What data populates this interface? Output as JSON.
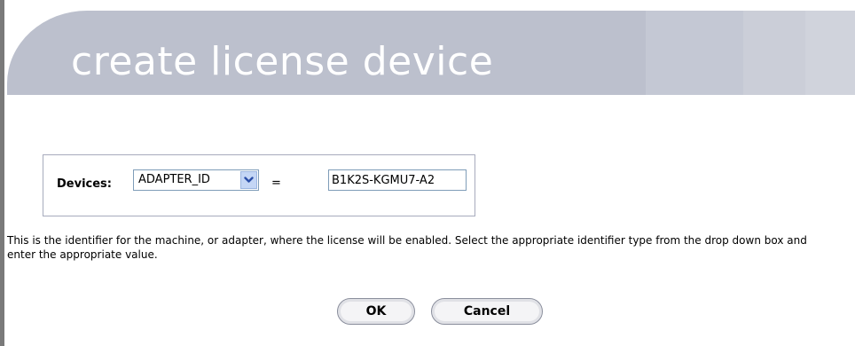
{
  "header": {
    "title": "create license device"
  },
  "device_form": {
    "label": "Devices:",
    "select": {
      "selected": "ADAPTER_ID",
      "arrow_icon": "chevron-down-icon"
    },
    "equals_sign": "=",
    "value_input": {
      "value": "B1K2S-KGMU7-A2"
    }
  },
  "help_text": "This is the identifier for the machine, or adapter, where the license will be enabled. Select the appropriate identifier type from the drop down box and enter the appropriate value.",
  "buttons": {
    "ok_label": "OK",
    "cancel_label": "Cancel"
  },
  "colors": {
    "header_background": "#bcc0cd",
    "header_text": "#ffffff",
    "box_border": "#a7abbd",
    "select_arrow_background": "#c4d6f5",
    "select_arrow_glyph": "#2b4fa8"
  }
}
